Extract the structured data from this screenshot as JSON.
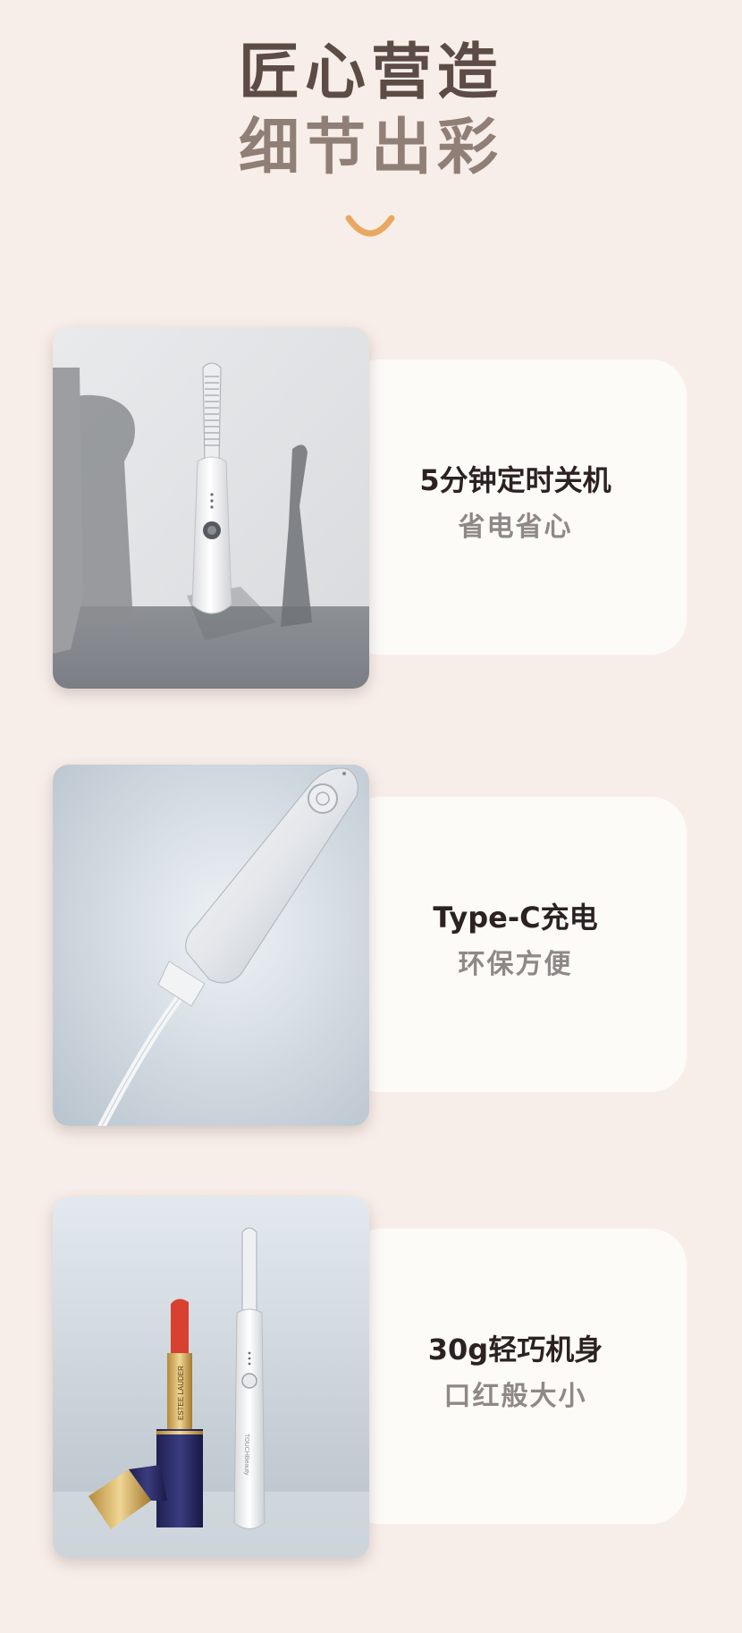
{
  "hero": {
    "title_line1": "匠心营造",
    "title_line2": "细节出彩",
    "accent_color": "#e9a861"
  },
  "features": [
    {
      "title": "5分钟定时关机",
      "subtitle": "省电省心",
      "image": "eyelash-curler-standing-photo"
    },
    {
      "title": "Type-C充电",
      "subtitle": "环保方便",
      "image": "usb-c-charging-photo"
    },
    {
      "title": "30g轻巧机身",
      "subtitle": "口红般大小",
      "image": "curler-next-to-lipstick-photo"
    }
  ],
  "product_print": {
    "brand_on_device": "TOUCHBeauty",
    "brand_on_lipstick": "ESTEE LAUDER"
  }
}
